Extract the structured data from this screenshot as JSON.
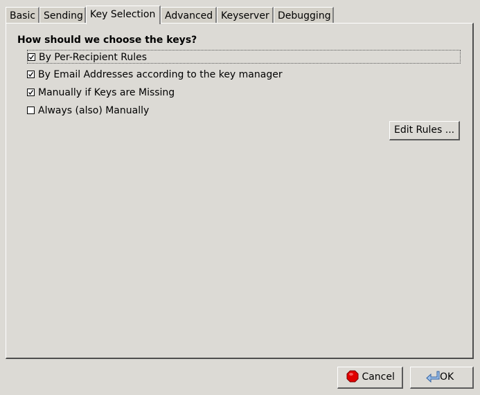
{
  "tabs": [
    {
      "label": "Basic",
      "active": false
    },
    {
      "label": "Sending",
      "active": false
    },
    {
      "label": "Key Selection",
      "active": true
    },
    {
      "label": "Advanced",
      "active": false
    },
    {
      "label": "Keyserver",
      "active": false
    },
    {
      "label": "Debugging",
      "active": false
    }
  ],
  "key_selection": {
    "question": "How should we choose the keys?",
    "options": [
      {
        "label": "By Per-Recipient Rules",
        "checked": true
      },
      {
        "label": "By Email Addresses according to the key manager",
        "checked": true
      },
      {
        "label": "Manually if Keys are Missing",
        "checked": true
      },
      {
        "label": "Always (also) Manually",
        "checked": false
      }
    ],
    "edit_rules_label": "Edit Rules ..."
  },
  "footer": {
    "cancel_label": "Cancel",
    "ok_label": "OK",
    "cancel_icon": "stop-icon",
    "ok_icon": "enter-arrow-icon"
  },
  "colors": {
    "window_bg": "#dcdad5",
    "cancel_icon_red": "#e00000",
    "ok_icon_blue": "#4a7fc1"
  }
}
